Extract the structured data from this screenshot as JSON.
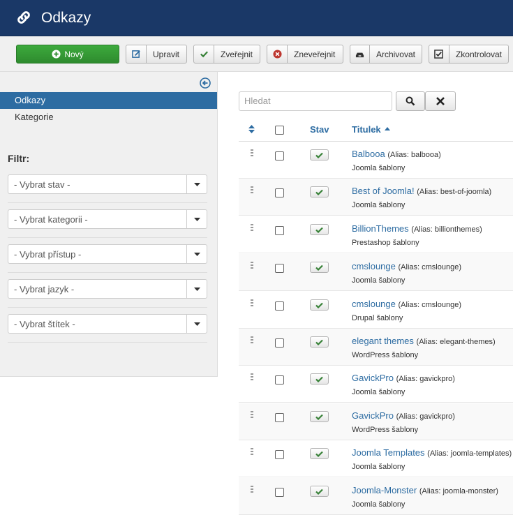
{
  "header": {
    "title": "Odkazy"
  },
  "toolbar": {
    "new_label": "Nový",
    "edit_label": "Upravit",
    "publish_label": "Zveřejnit",
    "unpublish_label": "Zneveřejnit",
    "archive_label": "Archivovat",
    "checkin_label": "Zkontrolovat"
  },
  "sidebar": {
    "items": [
      {
        "label": "Odkazy",
        "active": true
      },
      {
        "label": "Kategorie",
        "active": false
      }
    ],
    "filter_label": "Filtr:",
    "filters": [
      "- Vybrat stav -",
      "- Vybrat kategorii -",
      "- Vybrat přístup -",
      "- Vybrat jazyk -",
      "- Vybrat štítek -"
    ]
  },
  "search": {
    "placeholder": "Hledat"
  },
  "table": {
    "col_status": "Stav",
    "col_title": "Titulek",
    "rows": [
      {
        "title": "Balbooa",
        "alias": "(Alias: balbooa)",
        "category": "Joomla šablony"
      },
      {
        "title": "Best of Joomla!",
        "alias": "(Alias: best-of-joomla)",
        "category": "Joomla šablony"
      },
      {
        "title": "BillionThemes",
        "alias": "(Alias: billionthemes)",
        "category": "Prestashop šablony"
      },
      {
        "title": "cmslounge",
        "alias": "(Alias: cmslounge)",
        "category": "Joomla šablony"
      },
      {
        "title": "cmslounge",
        "alias": "(Alias: cmslounge)",
        "category": "Drupal šablony"
      },
      {
        "title": "elegant themes",
        "alias": "(Alias: elegant-themes)",
        "category": "WordPress šablony"
      },
      {
        "title": "GavickPro",
        "alias": "(Alias: gavickpro)",
        "category": "Joomla šablony"
      },
      {
        "title": "GavickPro",
        "alias": "(Alias: gavickpro)",
        "category": "WordPress šablony"
      },
      {
        "title": "Joomla Templates",
        "alias": "(Alias: joomla-templates)",
        "category": "Joomla šablony"
      },
      {
        "title": "Joomla-Monster",
        "alias": "(Alias: joomla-monster)",
        "category": "Joomla šablony"
      }
    ]
  },
  "colors": {
    "header_bg": "#1a3867",
    "accent": "#2d6ca2",
    "new_button": "#2e8b2e",
    "published": "#378137"
  },
  "icons": {
    "header": "link-icon",
    "new": "plus-circle-icon",
    "edit": "edit-icon",
    "publish": "check-icon",
    "unpublish": "x-circle-icon",
    "archive": "archive-icon",
    "checkin": "checkbox-icon",
    "collapse": "arrow-left-circle-icon",
    "search": "search-icon",
    "clear": "close-icon"
  }
}
